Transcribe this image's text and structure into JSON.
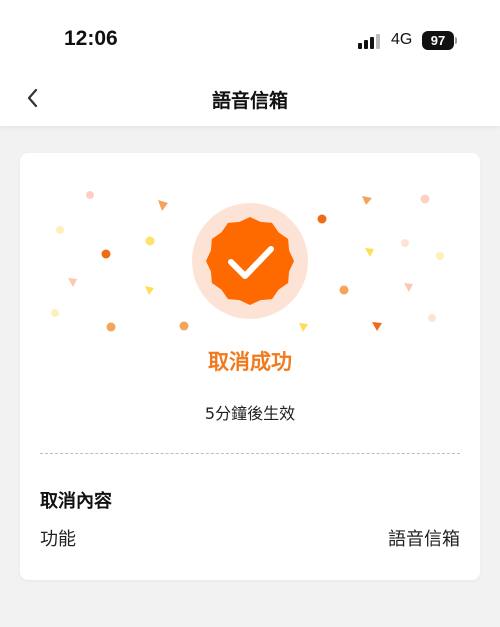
{
  "status_bar": {
    "time": "12:06",
    "network": "4G",
    "battery": "97"
  },
  "nav": {
    "title": "語音信箱",
    "back_icon": "chevron-left-icon"
  },
  "result": {
    "icon": "check-badge-icon",
    "title": "取消成功",
    "subtitle": "5分鐘後生效",
    "accent_color": "#ff6a00"
  },
  "details": {
    "section_title": "取消內容",
    "rows": [
      {
        "label": "功能",
        "value": "語音信箱"
      }
    ]
  }
}
